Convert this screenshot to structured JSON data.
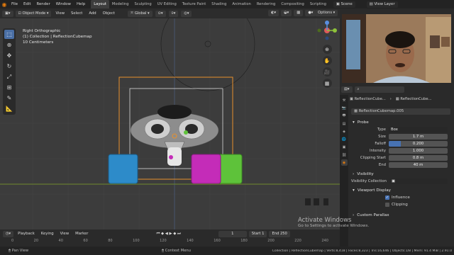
{
  "topbar": {
    "menus": [
      "File",
      "Edit",
      "Render",
      "Window",
      "Help"
    ],
    "workspaces": [
      "Layout",
      "Modeling",
      "Sculpting",
      "UV Editing",
      "Texture Paint",
      "Shading",
      "Animation",
      "Rendering",
      "Compositing",
      "Scripting"
    ],
    "active_workspace": "Layout",
    "scene": "Scene",
    "view_layer": "View Layer"
  },
  "viewport": {
    "mode": "Object Mode",
    "menus": [
      "View",
      "Select",
      "Add",
      "Object"
    ],
    "transform_orientation": "Global",
    "options_label": "Options",
    "view_name": "Right Orthographic",
    "collection_info": "(1) Collection | ReflectionCubemap",
    "scale_info": "10 Centimeters"
  },
  "timeline": {
    "menus": [
      "Playback",
      "Keying",
      "View",
      "Marker"
    ],
    "current_frame": "1",
    "start_label": "Start",
    "start": "1",
    "end_label": "End",
    "end": "250",
    "ruler": [
      "0",
      "20",
      "40",
      "60",
      "80",
      "100",
      "120",
      "140",
      "160",
      "180",
      "200",
      "220",
      "240"
    ]
  },
  "statusbar": {
    "left": "Pan View",
    "middle": "Context Menu",
    "stats": "Collection | ReflectionCubemap | Verts:8,418 | Faces:8,323 | Tris:16,646 | Objects:1/8 | Mem: 91.4 MiB | 2.91.0"
  },
  "properties": {
    "breadcrumb_object": "ReflectionCube...",
    "breadcrumb_data": "ReflectionCube...",
    "datablock_name": "ReflectionCubemap.005",
    "probe_section": "Probe",
    "fields": [
      {
        "label": "Type",
        "value": "Box",
        "fill": 0
      },
      {
        "label": "Size",
        "value": "1.7 m",
        "fill": 0
      },
      {
        "label": "Falloff",
        "value": "0.200",
        "fill": 0.2
      },
      {
        "label": "Intensity",
        "value": "1.000",
        "fill": 0
      },
      {
        "label": "Clipping Start",
        "value": "0.8 m",
        "fill": 0
      },
      {
        "label": "End",
        "value": "40 m",
        "fill": 0
      }
    ],
    "visibility_section": "Visibility",
    "visibility_collection_label": "Visibility Collection",
    "viewport_display_section": "Viewport Display",
    "influence_label": "Influence",
    "clipping_label": "Clipping",
    "custom_parallax_section": "Custom Parallax"
  },
  "watermark": {
    "title": "Activate Windows",
    "subtitle": "Go to Settings to activate Windows."
  },
  "colors": {
    "accent": "#4772b3",
    "blender_orange": "#e87d0d",
    "viewport_bg": "#3c3c3c",
    "cube_blue": "#2d8bc9",
    "cube_magenta": "#c42cb8",
    "cube_green": "#5ec23a"
  }
}
